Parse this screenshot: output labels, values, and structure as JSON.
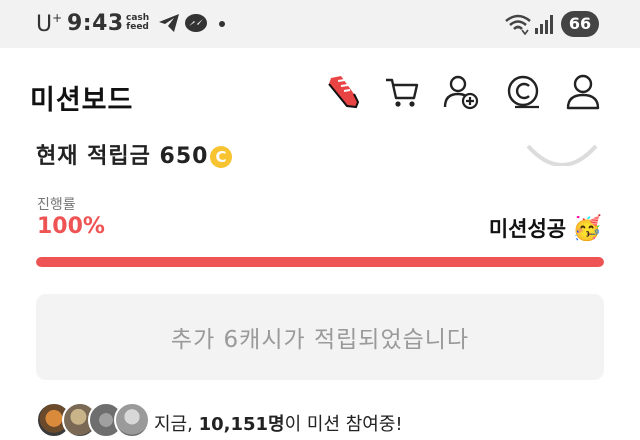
{
  "status_bar": {
    "carrier": "U",
    "carrier_sup": "+",
    "time": "9:43",
    "app_badge_line1": "cash",
    "app_badge_line2": "feed",
    "battery": "66",
    "icons": [
      "telegram-icon",
      "messenger-icon",
      "wifi-icon",
      "signal-icon"
    ]
  },
  "header": {
    "title": "미션보드",
    "actions": [
      "sneaker-icon",
      "cart-icon",
      "add-friend-icon",
      "coin-icon",
      "profile-icon"
    ]
  },
  "summary": {
    "accumulated_text": "현재 적립금 650",
    "coin_symbol": "C"
  },
  "progress": {
    "label": "진행률",
    "value_text": "100%",
    "value": 100,
    "status": "미션성공",
    "status_emoji": "🥳",
    "accent_color": "#ef5454"
  },
  "reward": {
    "message": "추가 6캐시가 적립되었습니다"
  },
  "participants": {
    "prefix": "지금, ",
    "count": "10,151명",
    "suffix": "이 미션 참여중!"
  }
}
